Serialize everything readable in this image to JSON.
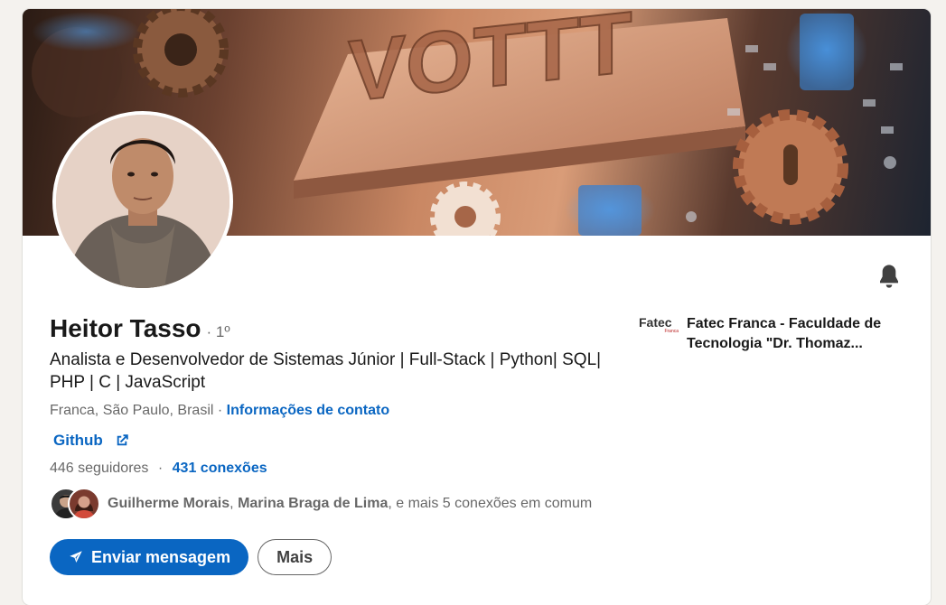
{
  "profile": {
    "name": "Heitor Tasso",
    "degree": "· 1º",
    "headline": "Analista e Desenvolvedor de Sistemas Júnior | Full-Stack | Python| SQL| PHP | C | JavaScript",
    "location": "Franca, São Paulo, Brasil",
    "location_sep": "·",
    "contact_info_label": "Informações de contato",
    "website_label": "Github",
    "followers": "446 seguidores",
    "stats_sep": "·",
    "connections": "431 conexões"
  },
  "banner": {
    "text": "VOTTT"
  },
  "mutual": {
    "name1": "Guilherme Morais",
    "separator": ",",
    "name2": "Marina Braga de Lima",
    "suffix": ", e mais 5 conexões em comum"
  },
  "actions": {
    "message_label": "Enviar mensagem",
    "more_label": "Mais"
  },
  "education": {
    "logo_text": "Fatec",
    "logo_subtext": "Franca",
    "name": "Fatec Franca - Faculdade de Tecnologia \"Dr. Thomaz..."
  },
  "icons": {
    "bell": "bell-icon",
    "external_link": "external-link-icon",
    "send": "send-icon"
  },
  "colors": {
    "accent": "#0a66c2",
    "background": "#f4f2ee"
  }
}
